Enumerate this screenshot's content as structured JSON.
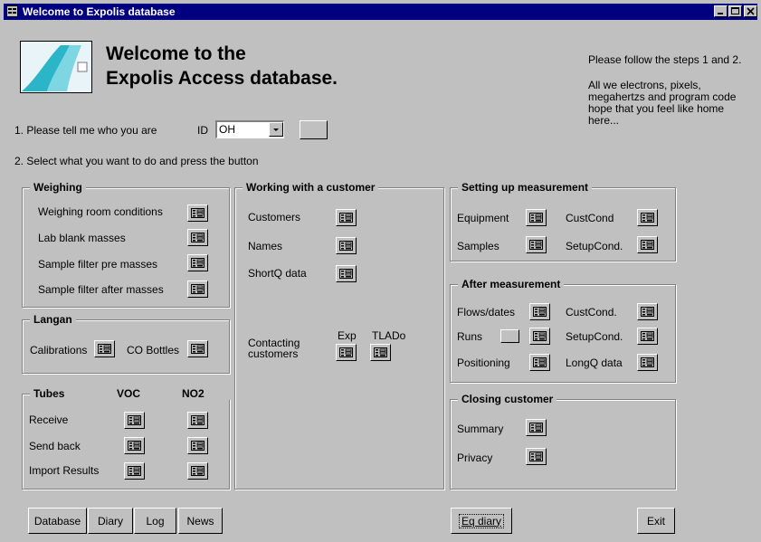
{
  "window": {
    "title": "Welcome to Expolis database"
  },
  "header": {
    "line1": "Welcome to the",
    "line2": "Expolis Access database.",
    "note_title": "Please follow the steps 1 and 2.",
    "note_lines": [
      "All we electrons, pixels,",
      "megahertzs and program code",
      "hope that you feel like home",
      "here..."
    ]
  },
  "step1": {
    "label": "1. Please tell me who you are",
    "id_label": "ID",
    "id_value": "OH"
  },
  "step2": {
    "label": "2. Select what you want to do and press the button"
  },
  "weighing": {
    "title": "Weighing",
    "items": [
      "Weighing room conditions",
      "Lab blank masses",
      "Sample filter pre masses",
      "Sample filter after masses"
    ]
  },
  "langan": {
    "title": "Langan",
    "calibrations": "Calibrations",
    "co_bottles": "CO Bottles"
  },
  "tubes": {
    "title": "Tubes",
    "col_voc": "VOC",
    "col_no2": "NO2",
    "rows": [
      "Receive",
      "Send back",
      "Import Results"
    ]
  },
  "customer": {
    "title": "Working with a customer",
    "items": [
      "Customers",
      "Names",
      "ShortQ data"
    ],
    "contacting": [
      "Contacting",
      "customers"
    ],
    "exp": "Exp",
    "tlado": "TLADo"
  },
  "setup": {
    "title": "Setting up measurement",
    "equipment": "Equipment",
    "custcond": "CustCond",
    "samples": "Samples",
    "setupcond": "SetupCond."
  },
  "after": {
    "title": "After measurement",
    "flows": "Flows/dates",
    "custcond": "CustCond.",
    "runs": "Runs",
    "setupcond": "SetupCond.",
    "positioning": "Positioning",
    "longq": "LongQ data"
  },
  "closing": {
    "title": "Closing customer",
    "summary": "Summary",
    "privacy": "Privacy"
  },
  "footer": {
    "database": "Database",
    "diary": "Diary",
    "log": "Log",
    "news": "News",
    "eq_diary": "Eq diary",
    "exit": "Exit"
  }
}
